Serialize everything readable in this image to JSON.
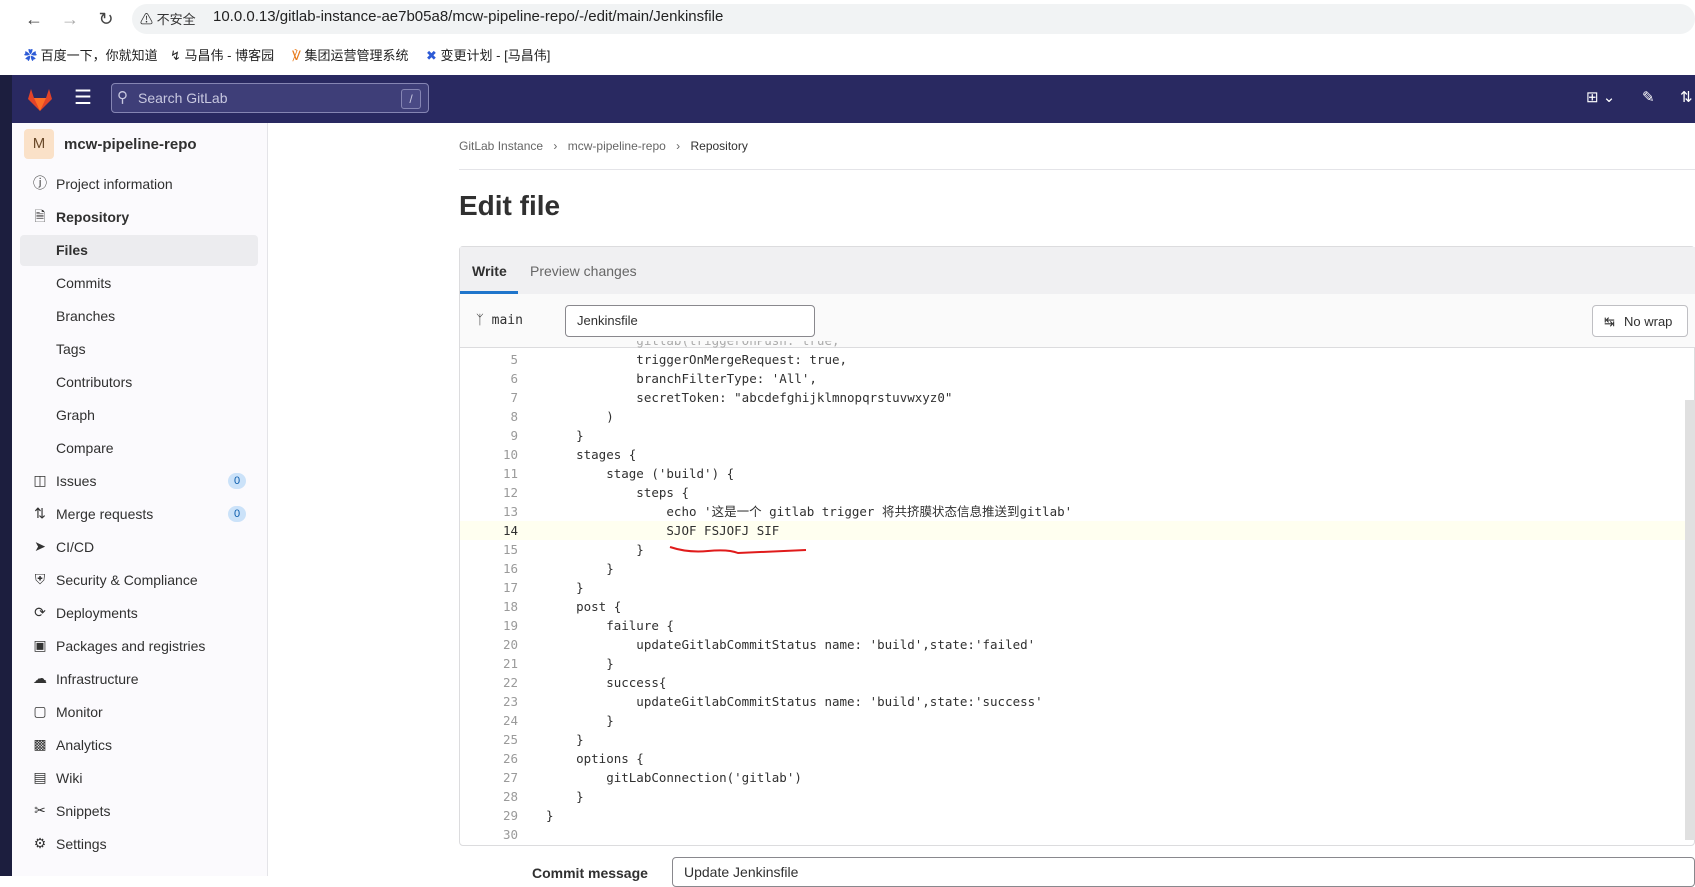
{
  "browser": {
    "security_label": "不安全",
    "url": "10.0.0.13/gitlab-instance-ae7b05a8/mcw-pipeline-repo/-/edit/main/Jenkinsfile",
    "bookmarks": [
      "百度一下，你就知道",
      "马昌伟 - 博客园",
      "集团运营管理系统",
      "变更计划 - [马昌伟]"
    ]
  },
  "header": {
    "search_placeholder": "Search GitLab",
    "search_shortcut": "/"
  },
  "sidebar": {
    "avatar_letter": "M",
    "project_name": "mcw-pipeline-repo",
    "items": [
      {
        "label": "Project information",
        "icon": "info-icon"
      },
      {
        "label": "Repository",
        "icon": "document-icon"
      },
      {
        "label": "Files"
      },
      {
        "label": "Commits"
      },
      {
        "label": "Branches"
      },
      {
        "label": "Tags"
      },
      {
        "label": "Contributors"
      },
      {
        "label": "Graph"
      },
      {
        "label": "Compare"
      },
      {
        "label": "Issues",
        "icon": "issues-icon",
        "badge": "0"
      },
      {
        "label": "Merge requests",
        "icon": "merge-request-icon",
        "badge": "0"
      },
      {
        "label": "CI/CD",
        "icon": "rocket-icon"
      },
      {
        "label": "Security & Compliance",
        "icon": "shield-icon"
      },
      {
        "label": "Deployments",
        "icon": "deployments-icon"
      },
      {
        "label": "Packages and registries",
        "icon": "package-icon"
      },
      {
        "label": "Infrastructure",
        "icon": "cloud-gear-icon"
      },
      {
        "label": "Monitor",
        "icon": "monitor-icon"
      },
      {
        "label": "Analytics",
        "icon": "chart-icon"
      },
      {
        "label": "Wiki",
        "icon": "book-icon"
      },
      {
        "label": "Snippets",
        "icon": "scissors-icon"
      },
      {
        "label": "Settings",
        "icon": "gear-icon"
      }
    ]
  },
  "breadcrumb": [
    "GitLab Instance",
    "mcw-pipeline-repo",
    "Repository"
  ],
  "page_title": "Edit file",
  "editor": {
    "tabs": [
      "Write",
      "Preview changes"
    ],
    "branch": "main",
    "filename": "Jenkinsfile",
    "nowrap_label": "No wrap",
    "lines": [
      {
        "n": "5",
        "text": "            triggerOnMergeRequest: true,"
      },
      {
        "n": "6",
        "text": "            branchFilterType: 'All',"
      },
      {
        "n": "7",
        "text": "            secretToken: \"abcdefghijklmnopqrstuvwxyz0\""
      },
      {
        "n": "8",
        "text": "        )"
      },
      {
        "n": "9",
        "text": "    }"
      },
      {
        "n": "10",
        "text": "    stages {"
      },
      {
        "n": "11",
        "text": "        stage ('build') {"
      },
      {
        "n": "12",
        "text": "            steps {"
      },
      {
        "n": "13",
        "text": "                echo '这是一个 gitlab trigger 将共挤膜状态信息推送到gitlab'"
      },
      {
        "n": "14",
        "text": "                SJOF FSJOFJ SIF "
      },
      {
        "n": "15",
        "text": "            }"
      },
      {
        "n": "16",
        "text": "        }"
      },
      {
        "n": "17",
        "text": "    }"
      },
      {
        "n": "18",
        "text": "    post {"
      },
      {
        "n": "19",
        "text": "        failure {"
      },
      {
        "n": "20",
        "text": "            updateGitlabCommitStatus name: 'build',state:'failed'"
      },
      {
        "n": "21",
        "text": "        }"
      },
      {
        "n": "22",
        "text": "        success{"
      },
      {
        "n": "23",
        "text": "            updateGitlabCommitStatus name: 'build',state:'success'"
      },
      {
        "n": "24",
        "text": "        }"
      },
      {
        "n": "25",
        "text": "    }"
      },
      {
        "n": "26",
        "text": "    options {"
      },
      {
        "n": "27",
        "text": "        gitLabConnection('gitlab')"
      },
      {
        "n": "28",
        "text": "    }"
      },
      {
        "n": "29",
        "text": "}"
      },
      {
        "n": "30",
        "text": ""
      }
    ]
  },
  "commit": {
    "label": "Commit message",
    "value": "Update Jenkinsfile"
  },
  "colors": {
    "header_bg": "#292961",
    "annotation_red": "#e01b1b"
  }
}
